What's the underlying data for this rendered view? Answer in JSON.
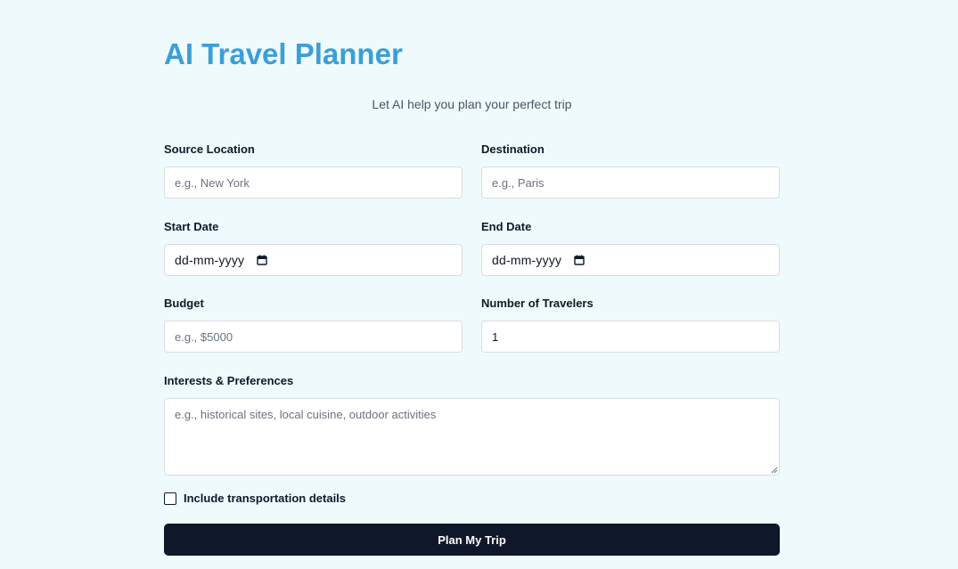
{
  "header": {
    "title": "AI Travel Planner",
    "subtitle": "Let AI help you plan your perfect trip"
  },
  "form": {
    "source": {
      "label": "Source Location",
      "placeholder": "e.g., New York",
      "value": ""
    },
    "destination": {
      "label": "Destination",
      "placeholder": "e.g., Paris",
      "value": ""
    },
    "start_date": {
      "label": "Start Date",
      "display": "dd-mm-yyyy",
      "icon": "calendar-icon"
    },
    "end_date": {
      "label": "End Date",
      "display": "dd-mm-yyyy",
      "icon": "calendar-icon"
    },
    "budget": {
      "label": "Budget",
      "placeholder": "e.g., $5000",
      "value": ""
    },
    "travelers": {
      "label": "Number of Travelers",
      "value": "1"
    },
    "interests": {
      "label": "Interests & Preferences",
      "placeholder": "e.g., historical sites, local cuisine, outdoor activities"
    },
    "transport": {
      "label": "Include transportation details",
      "checked": false
    },
    "submit_label": "Plan My Trip"
  },
  "colors": {
    "background": "#effafd",
    "title": "#3b9fd8",
    "button": "#0f172a",
    "button_text": "#ffffff"
  }
}
